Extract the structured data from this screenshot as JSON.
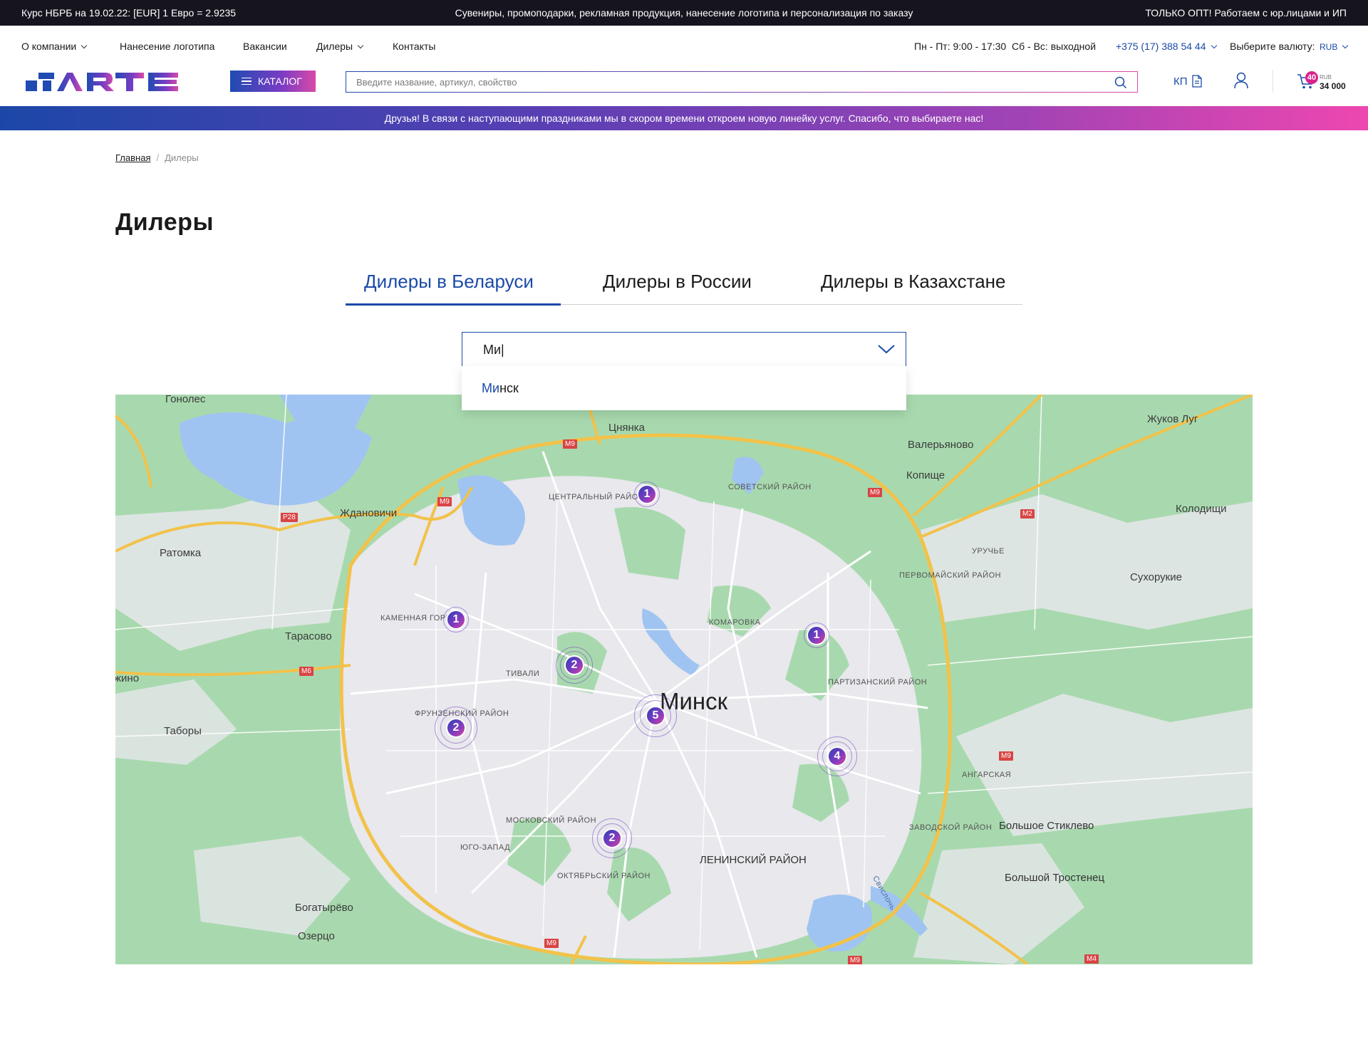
{
  "topbar": {
    "rate": "Курс НБРБ на 19.02.22: [EUR] 1 Евро = 2.9235",
    "tagline": "Сувениры, промоподарки, рекламная продукция, нанесение логотипа и персонализация по заказу",
    "wholesale": "ТОЛЬКО ОПТ! Работаем с юр.лицами и ИП"
  },
  "nav": {
    "items": [
      "О компании",
      "Нанесение логотипа",
      "Вакансии",
      "Дилеры",
      "Контакты"
    ],
    "hours_weekday": "Пн - Пт: 9:00 - 17:30",
    "hours_weekend": "Сб - Вс: выходной",
    "phone": "+375 (17) 388 54 44",
    "currency_label": "Выберите валюту:",
    "currency_value": "RUB"
  },
  "header": {
    "logo_text": "ARTE",
    "catalog_label": "КАТАЛОГ",
    "search_placeholder": "Введите название, артикул, свойство",
    "kp_label": "КП",
    "cart_count": "40",
    "cart_currency": "RUB",
    "cart_sum": "34 000"
  },
  "announcement": "Друзья! В связи с наступающими праздниками мы в скором времени откроем новую линейку услуг. Спасибо, что выбираете нас!",
  "breadcrumb": {
    "home": "Главная",
    "current": "Дилеры"
  },
  "page_title": "Дилеры",
  "tabs": [
    {
      "label": "Дилеры в Беларуси",
      "active": true
    },
    {
      "label": "Дилеры в России",
      "active": false
    },
    {
      "label": "Дилеры в Казахстане",
      "active": false
    }
  ],
  "city_select": {
    "value": "Ми|",
    "option_match": "Ми",
    "option_rest": "нск"
  },
  "map": {
    "city": "Минск",
    "places": [
      "Гонолес",
      "Цнянка",
      "Жуков Луг",
      "Валерьяново",
      "Копище",
      "Колодищи",
      "Ждановичи",
      "Ратомка",
      "Сухорукие",
      "Тарасово",
      "жино",
      "Таборы",
      "Богатырёво",
      "Озерцо",
      "Большое Стиклево",
      "Большой Тростенец"
    ],
    "districts": [
      "ЦЕНТРАЛЬНЫЙ РАЙОН",
      "СОВЕТСКИЙ РАЙОН",
      "УРУЧЬЕ",
      "ПЕРВОМАЙСКИЙ РАЙОН",
      "КАМЕННАЯ ГОРКА",
      "КОМАРОВКА",
      "ТИВАЛИ",
      "ПАРТИЗАНСКИЙ РАЙОН",
      "ФРУНЗЕНСКИЙ РАЙОН",
      "АНГАРСКАЯ",
      "МОСКОВСКИЙ РАЙОН",
      "ЮГО-ЗАПАД",
      "ЗАВОДСКОЙ РАЙОН",
      "ОКТЯБРЬСКИЙ РАЙОН",
      "ЛЕНИНСКИЙ РАЙОН",
      "Свислочь"
    ],
    "roads": [
      "M9",
      "M9",
      "M9",
      "M2",
      "P28",
      "M6",
      "M9",
      "M9",
      "M9",
      "M4"
    ],
    "clusters": [
      "1",
      "1",
      "1",
      "2",
      "5",
      "2",
      "4",
      "2"
    ]
  },
  "colors": {
    "brand_blue": "#1b4aa8",
    "brand_pink": "#d9238c",
    "topbar_bg": "#16151f"
  }
}
